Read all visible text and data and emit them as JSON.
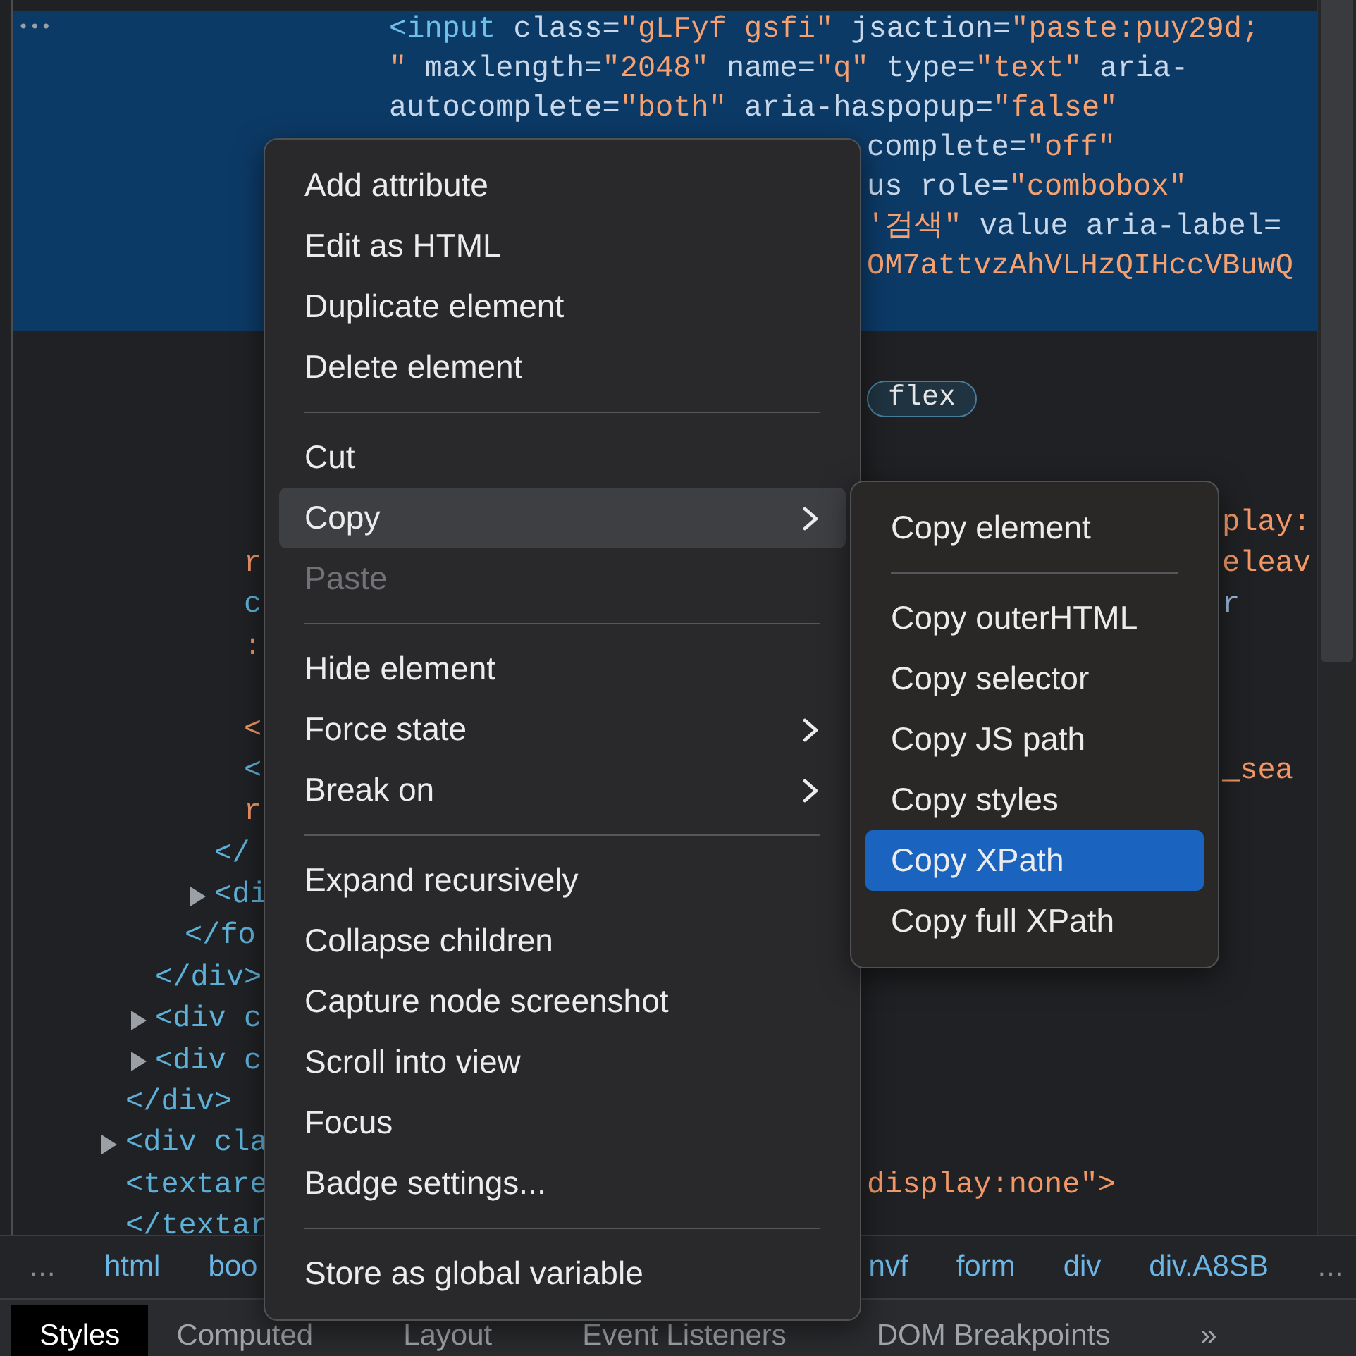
{
  "selected_node": {
    "marker": "•••",
    "lines": [
      {
        "kind": "full",
        "tokens": [
          {
            "text": "<input",
            "kind": "tag"
          },
          {
            "text": " class=",
            "kind": "attr"
          },
          {
            "text": "\"gLFyf gsfi\"",
            "kind": "value"
          },
          {
            "text": " jsaction=",
            "kind": "attr"
          },
          {
            "text": "\"paste:puy29d;",
            "kind": "value"
          }
        ]
      },
      {
        "kind": "full",
        "tokens": [
          {
            "text": "\"",
            "kind": "value"
          },
          {
            "text": " maxlength=",
            "kind": "attr"
          },
          {
            "text": "\"2048\"",
            "kind": "value"
          },
          {
            "text": " name=",
            "kind": "attr"
          },
          {
            "text": "\"q\"",
            "kind": "value"
          },
          {
            "text": " type=",
            "kind": "attr"
          },
          {
            "text": "\"text\"",
            "kind": "value"
          },
          {
            "text": " aria-",
            "kind": "attr"
          }
        ]
      },
      {
        "kind": "full",
        "tokens": [
          {
            "text": "autocomplete=",
            "kind": "attr"
          },
          {
            "text": "\"both\"",
            "kind": "value"
          },
          {
            "text": " aria-haspopup=",
            "kind": "attr"
          },
          {
            "text": "\"false\"",
            "kind": "value"
          }
        ]
      },
      {
        "kind": "partial",
        "tokens": [
          {
            "text": "complete=",
            "kind": "attr"
          },
          {
            "text": "\"off\"",
            "kind": "value"
          }
        ]
      },
      {
        "kind": "partial",
        "tokens": [
          {
            "text": "us role=",
            "kind": "attr"
          },
          {
            "text": "\"combobox\"",
            "kind": "value"
          }
        ]
      },
      {
        "kind": "partial",
        "tokens": [
          {
            "text": "'검색\"",
            "kind": "value"
          },
          {
            "text": " value aria-label=",
            "kind": "attr"
          }
        ]
      },
      {
        "kind": "partial",
        "tokens": [
          {
            "text": "OM7attvzAhVLHzQIHccVBuwQ",
            "kind": "value"
          }
        ]
      }
    ]
  },
  "dom_tree": [
    {
      "kind": "line",
      "children": [
        {
          "kind": "line",
          "right_of_menu": {
            "text": "flex",
            "kind": "badge"
          },
          "children": [
            {
              "kind": "line",
              "children": [
                {
                  "kind": "line",
                  "children": [
                    {
                      "kind": "line",
                      "right_of_submenu": {
                        "text": "play:",
                        "kind": "value"
                      }
                    },
                    {
                      "kind": "line",
                      "text": "r",
                      "right_of_submenu": {
                        "text": "eleav",
                        "kind": "value"
                      }
                    },
                    {
                      "kind": "line",
                      "text": "c",
                      "right_of_submenu": {
                        "text": "r",
                        "kind": "attr"
                      }
                    },
                    {
                      "kind": "line",
                      "text": ":"
                    },
                    {
                      "kind": "blank"
                    },
                    {
                      "kind": "line",
                      "text": "<"
                    },
                    {
                      "kind": "line",
                      "text": "<",
                      "right_of_submenu": {
                        "text": "_sea",
                        "kind": "value"
                      }
                    },
                    {
                      "kind": "line",
                      "text": "r"
                    }
                  ]
                },
                {
                  "kind": "line",
                  "text": "</"
                },
                {
                  "kind": "line",
                  "text": "<di",
                  "expanded": false
                }
              ]
            },
            {
              "kind": "line",
              "text": "</fo"
            }
          ]
        },
        {
          "kind": "line",
          "text": "</div>"
        },
        {
          "kind": "line",
          "text": "<div c",
          "expanded": false
        },
        {
          "kind": "line",
          "text": "<div c",
          "expanded": false
        }
      ]
    },
    {
      "kind": "line",
      "text": "</div>"
    },
    {
      "kind": "line",
      "text": "<div cla",
      "expanded": false
    },
    {
      "kind": "line",
      "text": "<textare",
      "right_of_menu": {
        "text": "display:none\">",
        "kind": "value"
      }
    },
    {
      "kind": "line",
      "text": "</textar"
    }
  ],
  "breadcrumbs": {
    "more_left": "…",
    "left": [
      "html",
      "boo"
    ],
    "right": [
      "nvf",
      "form",
      "div",
      "div.A8SB"
    ],
    "more_right": "…"
  },
  "panel_tabs": [
    {
      "label": "Styles",
      "selected": true
    },
    {
      "label": "Computed",
      "selected": false
    },
    {
      "label": "Layout",
      "selected": false
    },
    {
      "label": "Event Listeners",
      "selected": false
    },
    {
      "label": "DOM Breakpoints",
      "selected": false
    },
    {
      "label": "»",
      "selected": false
    }
  ],
  "menu": {
    "items": [
      {
        "kind": "item",
        "label": "Add attribute",
        "selected": false,
        "disabled": false,
        "submenu": false
      },
      {
        "kind": "item",
        "label": "Edit as HTML",
        "selected": false,
        "disabled": false,
        "submenu": false
      },
      {
        "kind": "item",
        "label": "Duplicate element",
        "selected": false,
        "disabled": false,
        "submenu": false
      },
      {
        "kind": "item",
        "label": "Delete element",
        "selected": false,
        "disabled": false,
        "submenu": false
      },
      {
        "kind": "separator"
      },
      {
        "kind": "item",
        "label": "Cut",
        "selected": false,
        "disabled": false,
        "submenu": false
      },
      {
        "kind": "item",
        "label": "Copy",
        "selected": true,
        "disabled": false,
        "submenu": true
      },
      {
        "kind": "item",
        "label": "Paste",
        "selected": false,
        "disabled": true,
        "submenu": false
      },
      {
        "kind": "separator"
      },
      {
        "kind": "item",
        "label": "Hide element",
        "selected": false,
        "disabled": false,
        "submenu": false
      },
      {
        "kind": "item",
        "label": "Force state",
        "selected": false,
        "disabled": false,
        "submenu": true
      },
      {
        "kind": "item",
        "label": "Break on",
        "selected": false,
        "disabled": false,
        "submenu": true
      },
      {
        "kind": "separator"
      },
      {
        "kind": "item",
        "label": "Expand recursively",
        "selected": false,
        "disabled": false,
        "submenu": false
      },
      {
        "kind": "item",
        "label": "Collapse children",
        "selected": false,
        "disabled": false,
        "submenu": false
      },
      {
        "kind": "item",
        "label": "Capture node screenshot",
        "selected": false,
        "disabled": false,
        "submenu": false
      },
      {
        "kind": "item",
        "label": "Scroll into view",
        "selected": false,
        "disabled": false,
        "submenu": false
      },
      {
        "kind": "item",
        "label": "Focus",
        "selected": false,
        "disabled": false,
        "submenu": false
      },
      {
        "kind": "item",
        "label": "Badge settings...",
        "selected": false,
        "disabled": false,
        "submenu": false
      },
      {
        "kind": "separator"
      },
      {
        "kind": "item",
        "label": "Store as global variable",
        "selected": false,
        "disabled": false,
        "submenu": false
      }
    ]
  },
  "submenu": {
    "items": [
      {
        "kind": "item",
        "label": "Copy element",
        "selected": false
      },
      {
        "kind": "separator"
      },
      {
        "kind": "item",
        "label": "Copy outerHTML",
        "selected": false
      },
      {
        "kind": "item",
        "label": "Copy selector",
        "selected": false
      },
      {
        "kind": "item",
        "label": "Copy JS path",
        "selected": false
      },
      {
        "kind": "item",
        "label": "Copy styles",
        "selected": false
      },
      {
        "kind": "item",
        "label": "Copy XPath",
        "selected": true
      },
      {
        "kind": "item",
        "label": "Copy full XPath",
        "selected": false
      }
    ]
  }
}
